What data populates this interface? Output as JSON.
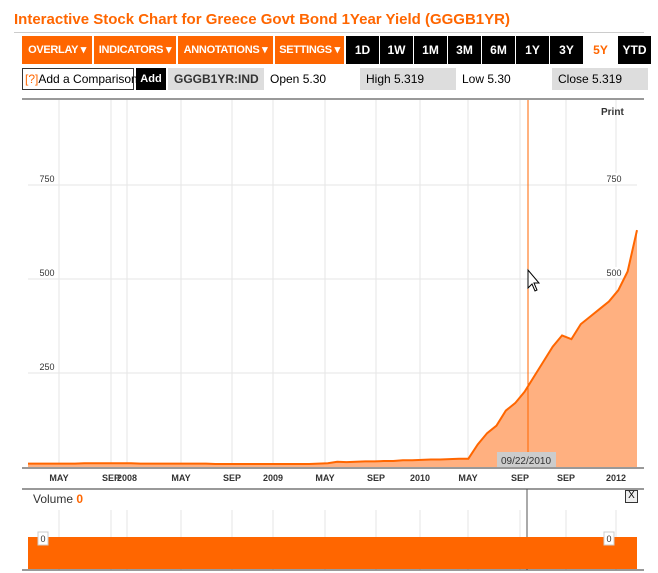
{
  "title": "Interactive Stock Chart for Greece Govt Bond 1Year Yield (GGGB1YR)",
  "menus": [
    "OVERLAY ▾",
    "INDICATORS ▾",
    "ANNOTATIONS ▾",
    "SETTINGS ▾"
  ],
  "ranges": [
    "1D",
    "1W",
    "1M",
    "3M",
    "6M",
    "1Y",
    "3Y",
    "5Y",
    "YTD"
  ],
  "selected_range": "5Y",
  "comparison": {
    "help": "[?]",
    "label": "Add a Comparison",
    "add": "Add"
  },
  "quote": {
    "ticker": "GGGB1YR:IND",
    "open": "Open 5.30",
    "high": "High 5.319",
    "low": "Low 5.30",
    "close": "Close 5.319"
  },
  "print_label": "Print",
  "tooltip_date": "09/22/2010",
  "volume": {
    "label": "Volume",
    "value": "0",
    "left_tag": "0",
    "right_tag": "0"
  },
  "close_label": "X",
  "colors": {
    "accent": "#ff6600",
    "fill": "#ffb080"
  },
  "chart_data": {
    "type": "area",
    "y_ticks": [
      250,
      500,
      750
    ],
    "ylim": [
      0,
      900
    ],
    "x_tick_labels": [
      "MAY",
      "SEP",
      "2008",
      "MAY",
      "SEP",
      "2009",
      "MAY",
      "SEP",
      "2010",
      "MAY",
      "SEP",
      "SEP",
      "2012"
    ],
    "values": [
      9,
      9,
      9,
      9,
      9,
      9,
      10,
      10,
      10,
      10,
      10,
      10,
      9,
      9,
      9,
      9,
      9,
      9,
      9,
      9,
      8,
      8,
      8,
      8,
      8,
      8,
      8,
      8,
      8,
      8,
      8,
      9,
      10,
      14,
      13,
      14,
      15,
      15,
      16,
      16,
      18,
      18,
      19,
      20,
      20,
      21,
      22,
      22,
      60,
      90,
      110,
      150,
      170,
      200,
      240,
      280,
      320,
      350,
      340,
      380,
      400,
      420,
      440,
      470,
      520,
      630
    ],
    "cursor_date": "09/22/2010"
  }
}
